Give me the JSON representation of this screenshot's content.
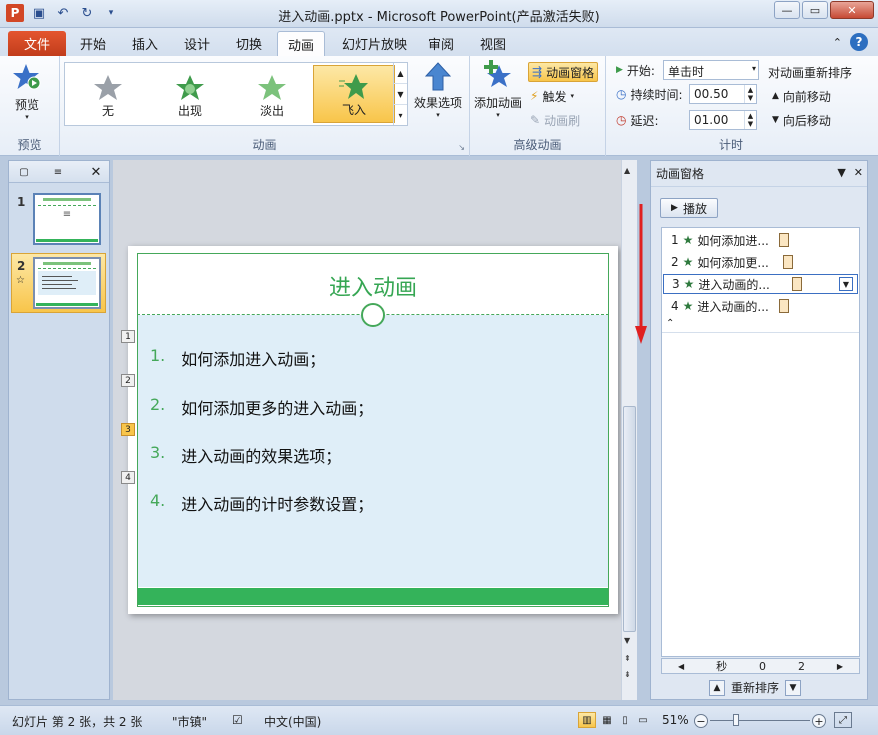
{
  "window": {
    "title": "进入动画.pptx - Microsoft PowerPoint(产品激活失败)"
  },
  "ribbon_tabs": [
    "文件",
    "开始",
    "插入",
    "设计",
    "切换",
    "动画",
    "幻灯片放映",
    "审阅",
    "视图"
  ],
  "active_tab": "动画",
  "ribbon": {
    "preview": {
      "button": "预览",
      "group": "预览"
    },
    "animation_gallery": {
      "items": [
        "无",
        "出现",
        "淡出",
        "飞入"
      ],
      "selected": "飞入",
      "effect_options": "效果选项",
      "group": "动画"
    },
    "advanced": {
      "add_animation": "添加动画",
      "animation_pane": "动画窗格",
      "trigger": "触发",
      "animation_painter": "动画刷",
      "group": "高级动画"
    },
    "timing": {
      "start_label": "开始:",
      "start_value": "单击时",
      "duration_label": "持续时间:",
      "duration_value": "00.50",
      "delay_label": "延迟:",
      "delay_value": "01.00",
      "reorder_title": "对动画重新排序",
      "move_earlier": "向前移动",
      "move_later": "向后移动",
      "group": "计时"
    }
  },
  "slides_pane": {
    "slides": [
      {
        "number": "1",
        "marker": ""
      },
      {
        "number": "2",
        "marker": "☆"
      }
    ],
    "selected": "2"
  },
  "slide": {
    "title": "进入动画",
    "items": [
      {
        "num": "1.",
        "text": "如何添加进入动画；",
        "tag": "1"
      },
      {
        "num": "2.",
        "text": "如何添加更多的进入动画；",
        "tag": "2"
      },
      {
        "num": "3.",
        "text": "进入动画的效果选项；",
        "tag": "3"
      },
      {
        "num": "4.",
        "text": "进入动画的计时参数设置；",
        "tag": "4"
      }
    ],
    "selected_tag": "3"
  },
  "animation_pane": {
    "title": "动画窗格",
    "play": "播放",
    "items": [
      {
        "num": "1",
        "label": "如何添加进..."
      },
      {
        "num": "2",
        "label": "如何添加更..."
      },
      {
        "num": "3",
        "label": "进入动画的..."
      },
      {
        "num": "4",
        "label": "进入动画的..."
      }
    ],
    "selected": "3",
    "scroll_labels": [
      "秒",
      "0",
      "2"
    ],
    "reorder": "重新排序"
  },
  "statusbar": {
    "slide_info": "幻灯片 第 2 张，共 2 张",
    "theme": "\"市镇\"",
    "language": "中文(中国)",
    "zoom": "51%"
  },
  "colors": {
    "accent_green": "#36a653",
    "file_tab": "#d24726",
    "highlight": "#f8c54a"
  }
}
